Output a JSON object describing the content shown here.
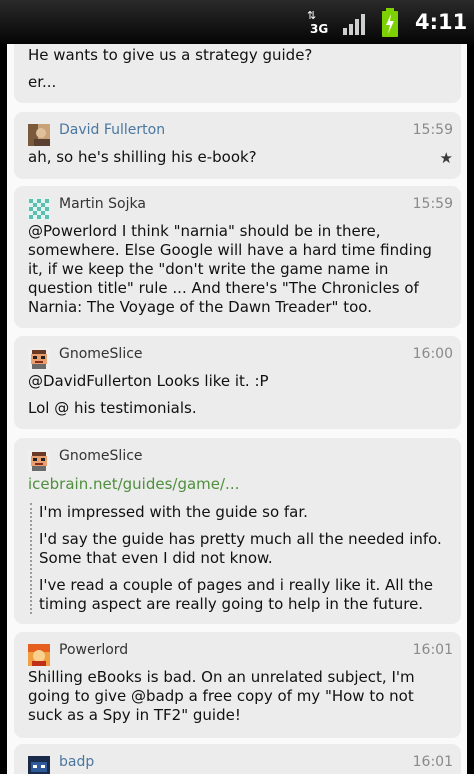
{
  "status_bar": {
    "network": "3G",
    "time": "4:11",
    "signal_icon": "signal-bars-icon",
    "battery_icon": "battery-charging-icon",
    "colors": {
      "battery": "#7dd100"
    }
  },
  "messages": [
    {
      "lines": [
        "He wants to give us a strategy guide?",
        "er..."
      ]
    },
    {
      "author": "David Fullerton",
      "time": "15:59",
      "text": "ah, so he's shilling his e-book?",
      "starred": true,
      "avatar_icon": "david-fullerton-avatar"
    },
    {
      "author": "Martin Sojka",
      "time": "15:59",
      "text": "@Powerlord I think \"narnia\" should be in there, somewhere. Else Google will have a hard time finding it, if we keep the \"don't write the game name in question title\" rule ... And there's \"The Chronicles of Narnia: The Voyage of the Dawn Treader\" too.",
      "avatar_icon": "martin-sojka-avatar"
    },
    {
      "author": "GnomeSlice",
      "time": "16:00",
      "lines": [
        "@DavidFullerton Looks like it. :P",
        "Lol @ his testimonials."
      ],
      "avatar_icon": "gnomeslice-avatar"
    },
    {
      "author": "GnomeSlice",
      "link": "icebrain.net/guides/game/...",
      "quotes": [
        "I'm impressed with the guide so far.",
        "I'd say the guide has pretty much all the needed info. Some that even I did not know.",
        "I've read a couple of pages and i really like it. All the timing aspect are really going to help in the future."
      ],
      "avatar_icon": "gnomeslice-avatar"
    },
    {
      "author": "Powerlord",
      "time": "16:01",
      "text": "Shilling eBooks is bad. On an unrelated subject, I'm going to give @badp a free copy of my \"How to not suck as a Spy in TF2\" guide!",
      "avatar_icon": "powerlord-avatar"
    },
    {
      "author": "badp",
      "time": "16:01",
      "avatar_icon": "badp-avatar"
    }
  ]
}
